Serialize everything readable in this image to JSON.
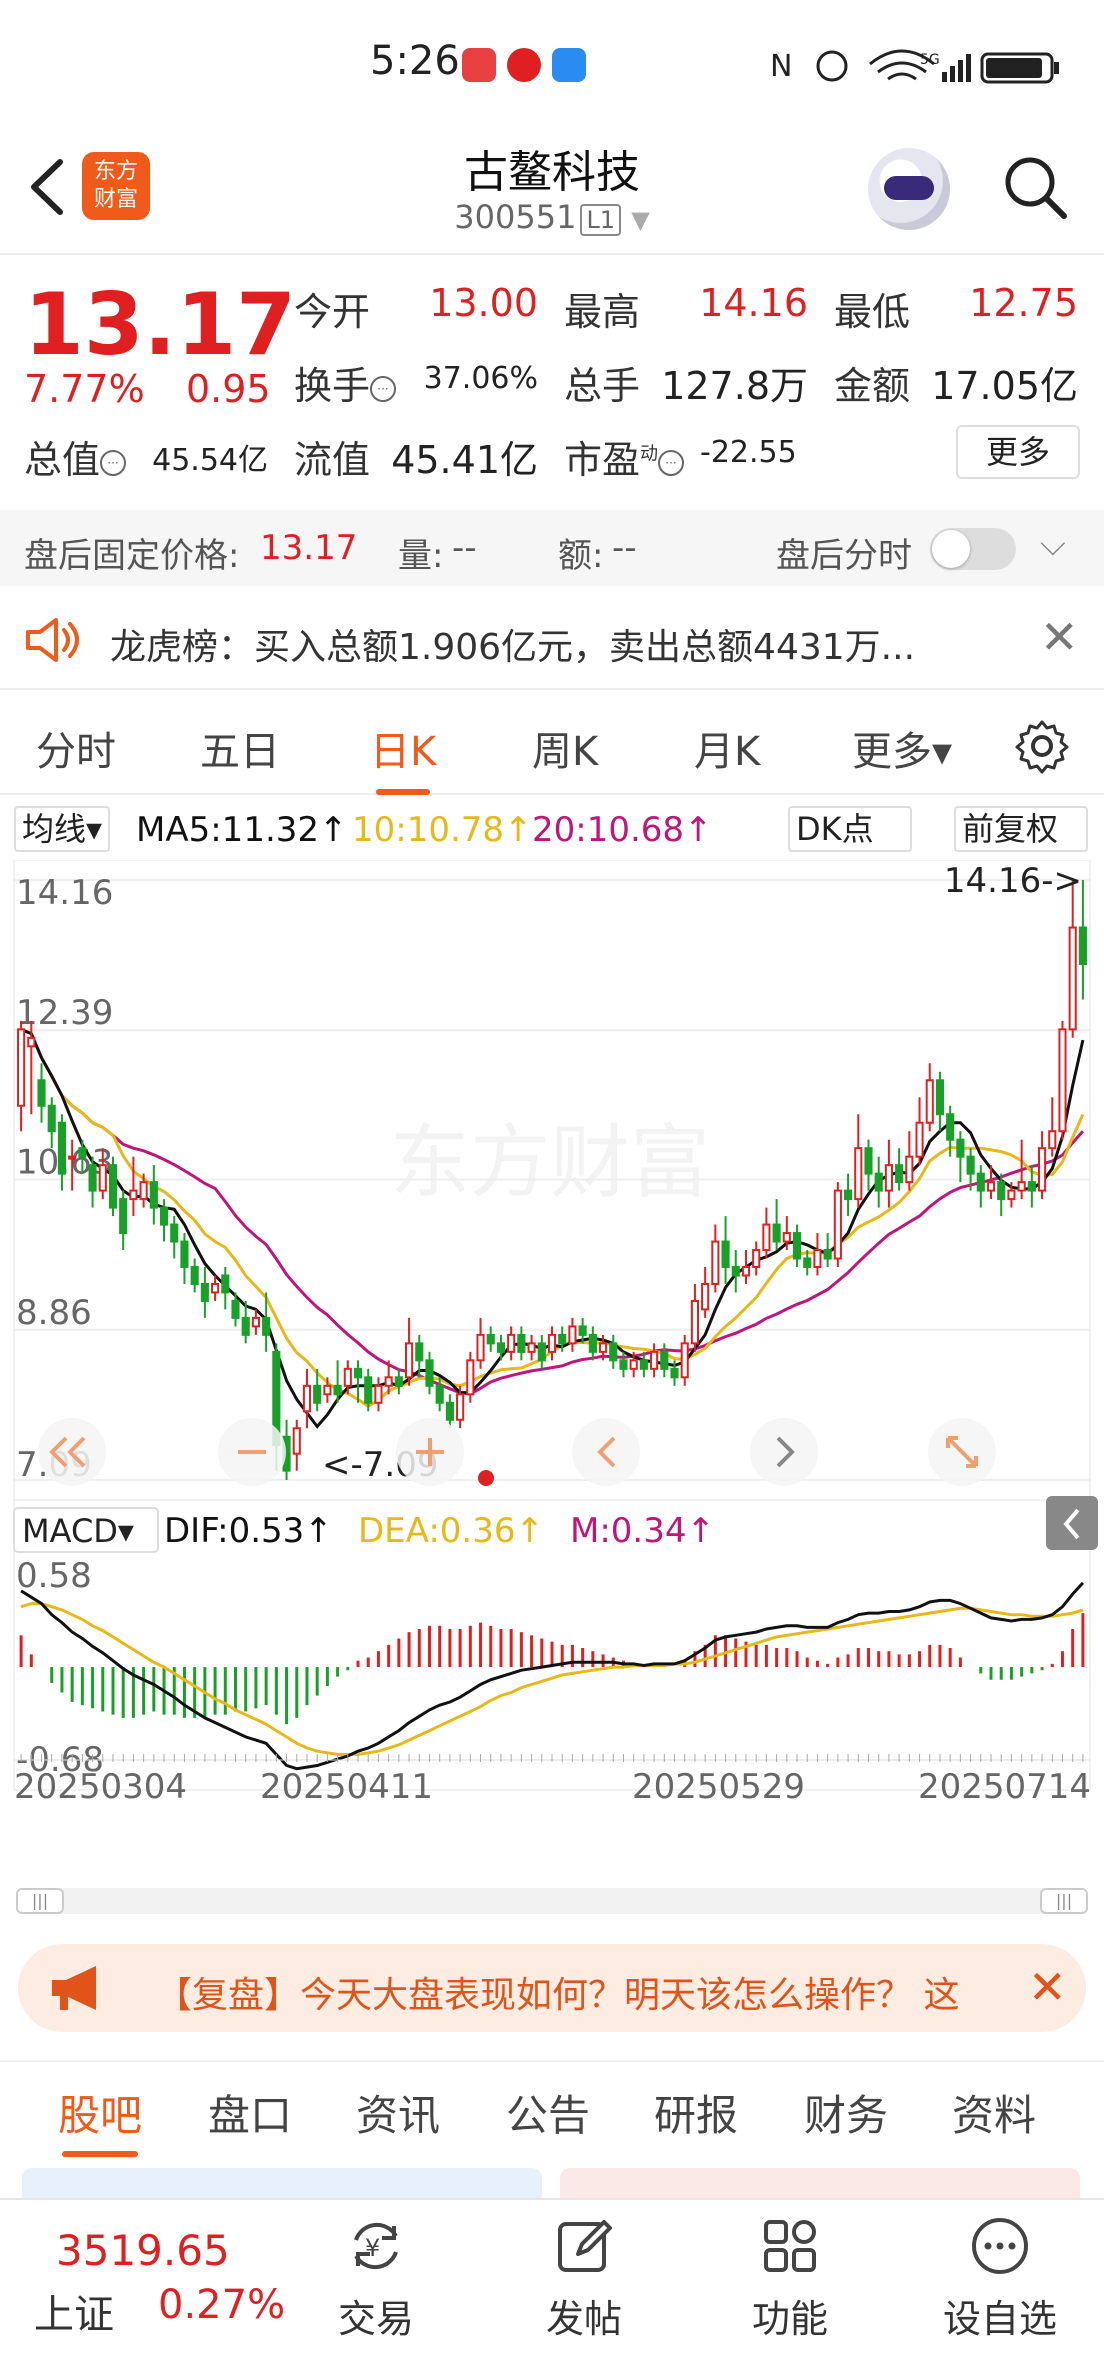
{
  "status_bar": {
    "time": "5:26",
    "indicators": "N ⏰ WiFi 5G",
    "app_icons": [
      "huawei-app-icon",
      "netease-music-icon",
      "message-bubble-icon"
    ]
  },
  "header": {
    "title": "古鳌科技",
    "code": "300551",
    "market_badge": "L1",
    "logo_text": [
      "东方",
      "财富"
    ]
  },
  "quote": {
    "price": "13.17",
    "change_pct": "7.77%",
    "change": "0.95",
    "open_label": "今开",
    "open": "13.00",
    "high_label": "最高",
    "high": "14.16",
    "low_label": "最低",
    "low": "12.75",
    "turnover_label": "换手",
    "turnover": "37.06%",
    "volume_label": "总手",
    "volume": "127.8万",
    "amount_label": "金额",
    "amount": "17.05亿",
    "mktcap_label": "总值",
    "mktcap": "45.54亿",
    "float_label": "流值",
    "float": "45.41亿",
    "pe_label": "市盈",
    "pe_sup": "动",
    "pe": "-22.55",
    "more_button": "更多"
  },
  "after_hours": {
    "price_label": "盘后固定价格:",
    "price": "13.17",
    "vol_label": "量:",
    "vol": "--",
    "amt_label": "额:",
    "amt": "--",
    "timeshare_label": "盘后分时"
  },
  "notice": {
    "text": "龙虎榜：买入总额1.906亿元，卖出总额4431万..."
  },
  "kline_tabs": [
    "分时",
    "五日",
    "日K",
    "周K",
    "月K",
    "更多▾"
  ],
  "active_kline_tab": "日K",
  "ma_row": {
    "selector": "均线▾",
    "ma5": "MA5:11.32↑",
    "ma10": "10:10.78↑",
    "ma20": "20:10.68↑",
    "dk": "DK点",
    "adjust": "前复权"
  },
  "colors": {
    "up": "#e02020",
    "down": "#18a028",
    "ma5": "#111111",
    "ma10": "#e8b818",
    "ma20": "#c0157a",
    "accent": "#f05a1a"
  },
  "chart_data": [
    {
      "type": "candlestick",
      "title": "",
      "y_ticks": [
        "14.16",
        "12.39",
        "10.63",
        "8.86",
        "7.09"
      ],
      "ylim": [
        7.09,
        14.16
      ],
      "high_marker": "14.16->",
      "low_marker": "<-7.09",
      "watermark": "东方财富",
      "ma_legend": [
        "MA5",
        "10",
        "20"
      ],
      "candles": [
        [
          11.5,
          12.4,
          11.2,
          12.5
        ],
        [
          12.2,
          12.3,
          11.4,
          12.5
        ],
        [
          11.8,
          11.5,
          11.3,
          12.0
        ],
        [
          11.5,
          11.2,
          11.0,
          11.6
        ],
        [
          11.3,
          10.7,
          10.5,
          11.4
        ],
        [
          10.9,
          10.9,
          10.5,
          11.1
        ],
        [
          11.0,
          10.9,
          10.7,
          11.1
        ],
        [
          10.8,
          10.5,
          10.3,
          10.9
        ],
        [
          10.5,
          10.8,
          10.4,
          11.0
        ],
        [
          10.8,
          10.3,
          10.2,
          10.9
        ],
        [
          10.4,
          10.0,
          9.8,
          10.5
        ],
        [
          10.4,
          10.5,
          10.2,
          10.9
        ],
        [
          10.4,
          10.6,
          10.3,
          10.7
        ],
        [
          10.6,
          10.3,
          10.1,
          10.8
        ],
        [
          10.3,
          10.1,
          9.9,
          10.4
        ],
        [
          10.1,
          9.9,
          9.7,
          10.2
        ],
        [
          9.9,
          9.6,
          9.4,
          10.0
        ],
        [
          9.6,
          9.4,
          9.3,
          9.7
        ],
        [
          9.4,
          9.2,
          9.0,
          9.6
        ],
        [
          9.3,
          9.4,
          9.2,
          9.5
        ],
        [
          9.5,
          9.3,
          9.1,
          9.6
        ],
        [
          9.2,
          9.0,
          8.9,
          9.3
        ],
        [
          9.0,
          8.8,
          8.7,
          9.2
        ],
        [
          8.9,
          9.0,
          8.8,
          9.1
        ],
        [
          9.0,
          8.8,
          8.6,
          9.3
        ],
        [
          8.6,
          7.5,
          7.2,
          8.7
        ],
        [
          7.6,
          7.2,
          7.09,
          7.8
        ],
        [
          7.4,
          7.7,
          7.2,
          7.8
        ],
        [
          7.9,
          8.2,
          7.7,
          8.4
        ],
        [
          8.2,
          8.0,
          7.9,
          8.4
        ],
        [
          8.1,
          8.2,
          8.0,
          8.3
        ],
        [
          8.2,
          8.1,
          8.0,
          8.5
        ],
        [
          8.2,
          8.4,
          8.1,
          8.5
        ],
        [
          8.4,
          8.3,
          8.0,
          8.5
        ],
        [
          8.3,
          8.0,
          7.9,
          8.4
        ],
        [
          8.0,
          8.2,
          7.9,
          8.3
        ],
        [
          8.2,
          8.3,
          8.1,
          8.5
        ],
        [
          8.3,
          8.2,
          8.1,
          8.4
        ],
        [
          8.3,
          8.7,
          8.2,
          9.0
        ],
        [
          8.7,
          8.5,
          8.3,
          8.8
        ],
        [
          8.5,
          8.2,
          8.1,
          8.6
        ],
        [
          8.2,
          8.0,
          7.9,
          8.3
        ],
        [
          8.0,
          7.8,
          7.7,
          8.1
        ],
        [
          7.8,
          8.1,
          7.7,
          8.2
        ],
        [
          8.1,
          8.5,
          8.0,
          8.6
        ],
        [
          8.5,
          8.8,
          8.4,
          9.0
        ],
        [
          8.8,
          8.7,
          8.6,
          8.9
        ],
        [
          8.7,
          8.6,
          8.5,
          8.8
        ],
        [
          8.6,
          8.8,
          8.5,
          8.9
        ],
        [
          8.8,
          8.6,
          8.5,
          8.9
        ],
        [
          8.6,
          8.7,
          8.5,
          8.8
        ],
        [
          8.7,
          8.5,
          8.4,
          8.8
        ],
        [
          8.6,
          8.8,
          8.5,
          8.9
        ],
        [
          8.8,
          8.7,
          8.6,
          8.9
        ],
        [
          8.7,
          8.9,
          8.6,
          9.0
        ],
        [
          8.9,
          8.8,
          8.7,
          9.0
        ],
        [
          8.8,
          8.6,
          8.5,
          8.9
        ],
        [
          8.6,
          8.7,
          8.5,
          8.8
        ],
        [
          8.7,
          8.5,
          8.4,
          8.8
        ],
        [
          8.5,
          8.4,
          8.3,
          8.6
        ],
        [
          8.4,
          8.5,
          8.3,
          8.6
        ],
        [
          8.5,
          8.4,
          8.3,
          8.6
        ],
        [
          8.4,
          8.6,
          8.3,
          8.7
        ],
        [
          8.6,
          8.4,
          8.3,
          8.7
        ],
        [
          8.4,
          8.3,
          8.2,
          8.5
        ],
        [
          8.3,
          8.7,
          8.2,
          8.8
        ],
        [
          8.7,
          9.2,
          8.6,
          9.4
        ],
        [
          9.1,
          9.4,
          9.0,
          9.6
        ],
        [
          9.4,
          9.9,
          9.3,
          10.1
        ],
        [
          9.9,
          9.6,
          9.4,
          10.2
        ],
        [
          9.6,
          9.5,
          9.3,
          9.8
        ],
        [
          9.5,
          9.6,
          9.4,
          9.8
        ],
        [
          9.6,
          9.8,
          9.5,
          9.9
        ],
        [
          9.8,
          10.1,
          9.7,
          10.3
        ],
        [
          10.1,
          9.9,
          9.8,
          10.4
        ],
        [
          9.9,
          10.0,
          9.8,
          10.2
        ],
        [
          10.0,
          9.7,
          9.6,
          10.1
        ],
        [
          9.7,
          9.6,
          9.5,
          9.8
        ],
        [
          9.6,
          9.8,
          9.5,
          10.0
        ],
        [
          9.8,
          9.7,
          9.6,
          10.0
        ],
        [
          9.7,
          10.5,
          9.6,
          10.6
        ],
        [
          10.5,
          10.4,
          10.2,
          10.7
        ],
        [
          10.4,
          11.0,
          10.3,
          11.4
        ],
        [
          11.0,
          10.7,
          10.5,
          11.1
        ],
        [
          10.7,
          10.5,
          10.3,
          10.9
        ],
        [
          10.5,
          10.8,
          10.3,
          11.1
        ],
        [
          10.8,
          10.6,
          10.5,
          11.0
        ],
        [
          10.6,
          10.9,
          10.5,
          11.2
        ],
        [
          10.9,
          11.3,
          10.8,
          11.6
        ],
        [
          11.3,
          11.8,
          11.2,
          12.0
        ],
        [
          11.8,
          11.4,
          11.2,
          11.9
        ],
        [
          11.4,
          11.1,
          10.9,
          11.5
        ],
        [
          11.1,
          10.9,
          10.6,
          11.2
        ],
        [
          10.9,
          10.7,
          10.5,
          11.0
        ],
        [
          10.7,
          10.5,
          10.3,
          10.8
        ],
        [
          10.5,
          10.6,
          10.4,
          10.8
        ],
        [
          10.6,
          10.4,
          10.2,
          10.7
        ],
        [
          10.4,
          10.5,
          10.3,
          10.6
        ],
        [
          10.5,
          10.6,
          10.4,
          11.1
        ],
        [
          10.6,
          10.5,
          10.3,
          10.8
        ],
        [
          10.5,
          11.0,
          10.4,
          11.2
        ],
        [
          11.0,
          11.2,
          10.9,
          11.6
        ],
        [
          11.2,
          12.4,
          11.1,
          12.5
        ],
        [
          12.4,
          13.6,
          12.3,
          14.16
        ],
        [
          13.6,
          13.17,
          12.75,
          14.16
        ]
      ]
    },
    {
      "type": "macd",
      "title": "",
      "selector": "MACD▾",
      "dif_label": "DIF:0.53↑",
      "dea_label": "DEA:0.36↑",
      "m_label": "M:0.34↑",
      "y_ticks": [
        "0.58",
        "-0.68"
      ],
      "ylim": [
        -0.68,
        0.58
      ],
      "x_ticks": [
        "20250304",
        "20250411",
        "20250529",
        "20250714"
      ],
      "dif": [
        0.48,
        0.44,
        0.4,
        0.33,
        0.28,
        0.22,
        0.18,
        0.13,
        0.09,
        0.04,
        -0.01,
        -0.05,
        -0.08,
        -0.11,
        -0.15,
        -0.19,
        -0.24,
        -0.28,
        -0.32,
        -0.35,
        -0.38,
        -0.41,
        -0.44,
        -0.46,
        -0.48,
        -0.55,
        -0.62,
        -0.64,
        -0.63,
        -0.62,
        -0.6,
        -0.58,
        -0.56,
        -0.53,
        -0.51,
        -0.48,
        -0.44,
        -0.4,
        -0.35,
        -0.31,
        -0.27,
        -0.24,
        -0.22,
        -0.19,
        -0.15,
        -0.11,
        -0.08,
        -0.06,
        -0.04,
        -0.02,
        -0.01,
        0.0,
        0.01,
        0.02,
        0.03,
        0.03,
        0.03,
        0.03,
        0.03,
        0.02,
        0.02,
        0.01,
        0.02,
        0.02,
        0.02,
        0.04,
        0.08,
        0.12,
        0.17,
        0.19,
        0.2,
        0.21,
        0.22,
        0.24,
        0.25,
        0.26,
        0.26,
        0.25,
        0.25,
        0.25,
        0.28,
        0.3,
        0.33,
        0.34,
        0.34,
        0.35,
        0.35,
        0.36,
        0.38,
        0.41,
        0.42,
        0.42,
        0.4,
        0.37,
        0.34,
        0.31,
        0.3,
        0.29,
        0.3,
        0.3,
        0.31,
        0.33,
        0.38,
        0.46,
        0.53
      ],
      "dea": [
        0.38,
        0.4,
        0.4,
        0.38,
        0.36,
        0.33,
        0.3,
        0.26,
        0.23,
        0.19,
        0.15,
        0.11,
        0.07,
        0.03,
        0.0,
        -0.04,
        -0.08,
        -0.12,
        -0.16,
        -0.2,
        -0.23,
        -0.27,
        -0.3,
        -0.33,
        -0.36,
        -0.4,
        -0.44,
        -0.48,
        -0.51,
        -0.53,
        -0.54,
        -0.55,
        -0.55,
        -0.55,
        -0.54,
        -0.53,
        -0.51,
        -0.49,
        -0.46,
        -0.43,
        -0.4,
        -0.37,
        -0.34,
        -0.31,
        -0.28,
        -0.25,
        -0.21,
        -0.18,
        -0.16,
        -0.13,
        -0.11,
        -0.09,
        -0.07,
        -0.05,
        -0.04,
        -0.03,
        -0.02,
        -0.01,
        0.0,
        0.0,
        0.01,
        0.01,
        0.01,
        0.01,
        0.02,
        0.02,
        0.03,
        0.05,
        0.07,
        0.09,
        0.11,
        0.13,
        0.15,
        0.17,
        0.19,
        0.2,
        0.21,
        0.22,
        0.23,
        0.24,
        0.25,
        0.26,
        0.27,
        0.28,
        0.29,
        0.3,
        0.31,
        0.32,
        0.33,
        0.34,
        0.35,
        0.36,
        0.37,
        0.37,
        0.36,
        0.35,
        0.34,
        0.33,
        0.33,
        0.32,
        0.32,
        0.32,
        0.33,
        0.34,
        0.36
      ]
    }
  ],
  "chart_nav_buttons": [
    "rewind-icon",
    "zoom-out-icon",
    "zoom-in-icon",
    "prev-icon",
    "next-icon",
    "fullscreen-icon"
  ],
  "promo": {
    "text": "【复盘】今天大盘表现如何？明天该怎么操作？ 这"
  },
  "sub_tabs": [
    "股吧",
    "盘口",
    "资讯",
    "公告",
    "研报",
    "财务",
    "资料"
  ],
  "active_sub_tab": "股吧",
  "bottom_bar": {
    "index_value": "3519.65",
    "index_name": "上证",
    "index_pct": "0.27%",
    "nav": [
      {
        "label": "交易",
        "icon": "yuan-exchange-icon"
      },
      {
        "label": "发帖",
        "icon": "edit-post-icon"
      },
      {
        "label": "功能",
        "icon": "grid-apps-icon"
      },
      {
        "label": "设自选",
        "icon": "more-dots-icon"
      }
    ]
  }
}
